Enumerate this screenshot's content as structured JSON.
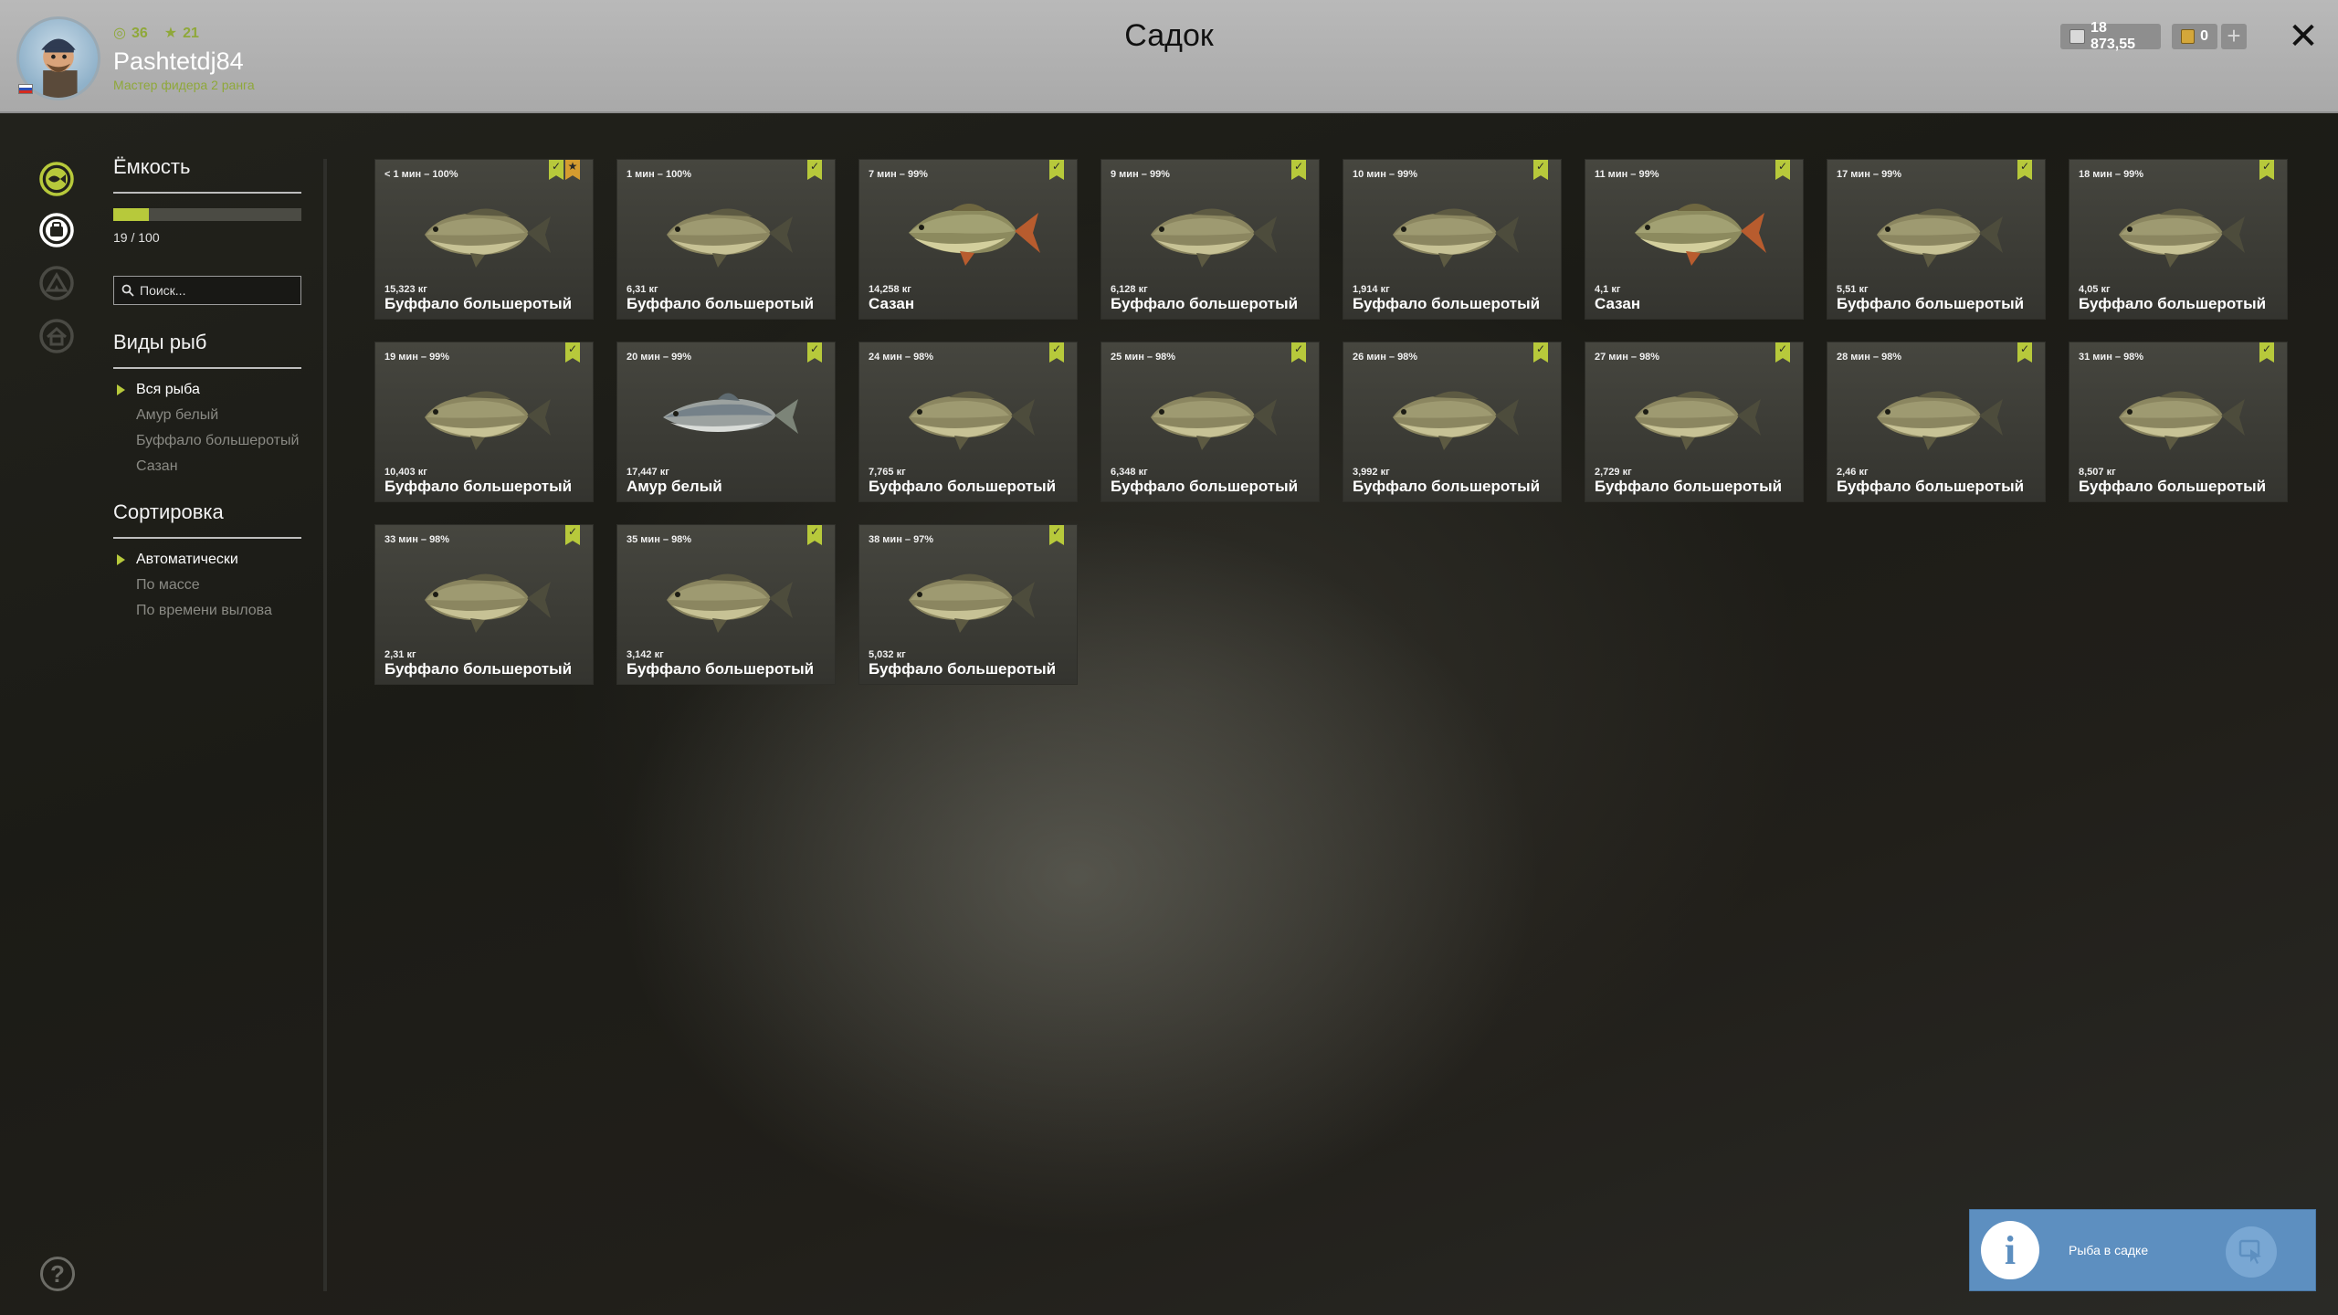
{
  "header": {
    "title": "Садок",
    "player": {
      "name": "Pashtetdj84",
      "rank": "Мастер фидера 2 ранга",
      "level": "36",
      "stars": "21"
    },
    "currency": {
      "silver": "18 873,55",
      "gold": "0"
    },
    "plus_label": "+",
    "close_label": "✕"
  },
  "nav": {
    "icons": [
      "fish-keepnet-icon",
      "inventory-bag-icon",
      "tent-icon",
      "house-icon"
    ],
    "help_label": "?"
  },
  "capacity": {
    "title": "Ёмкость",
    "text": "19 / 100",
    "fraction": 0.19
  },
  "search": {
    "placeholder": "Поиск..."
  },
  "types": {
    "title": "Виды рыб",
    "items": [
      "Вся рыба",
      "Амур белый",
      "Буффало большеротый",
      "Сазан"
    ],
    "active": 0
  },
  "sort": {
    "title": "Сортировка",
    "items": [
      "Автоматически",
      "По массе",
      "По времени вылова"
    ],
    "active": 0
  },
  "fish": [
    {
      "time": "< 1 мин – 100%",
      "weight": "15,323 кг",
      "name": "Буффало большеротый",
      "kind": "buffalo",
      "star": true
    },
    {
      "time": "1 мин – 100%",
      "weight": "6,31 кг",
      "name": "Буффало большеротый",
      "kind": "buffalo",
      "star": false
    },
    {
      "time": "7 мин – 99%",
      "weight": "14,258 кг",
      "name": "Сазан",
      "kind": "carp",
      "star": false
    },
    {
      "time": "9 мин – 99%",
      "weight": "6,128 кг",
      "name": "Буффало большеротый",
      "kind": "buffalo",
      "star": false
    },
    {
      "time": "10 мин – 99%",
      "weight": "1,914 кг",
      "name": "Буффало большеротый",
      "kind": "buffalo",
      "star": false
    },
    {
      "time": "11 мин – 99%",
      "weight": "4,1 кг",
      "name": "Сазан",
      "kind": "carp",
      "star": false
    },
    {
      "time": "17 мин – 99%",
      "weight": "5,51 кг",
      "name": "Буффало большеротый",
      "kind": "buffalo",
      "star": false
    },
    {
      "time": "18 мин – 99%",
      "weight": "4,05 кг",
      "name": "Буффало большеротый",
      "kind": "buffalo",
      "star": false
    },
    {
      "time": "19 мин – 99%",
      "weight": "10,403 кг",
      "name": "Буффало большеротый",
      "kind": "buffalo",
      "star": false
    },
    {
      "time": "20 мин – 99%",
      "weight": "17,447 кг",
      "name": "Амур белый",
      "kind": "amur",
      "star": false
    },
    {
      "time": "24 мин – 98%",
      "weight": "7,765 кг",
      "name": "Буффало большеротый",
      "kind": "buffalo",
      "star": false
    },
    {
      "time": "25 мин – 98%",
      "weight": "6,348 кг",
      "name": "Буффало большеротый",
      "kind": "buffalo",
      "star": false
    },
    {
      "time": "26 мин – 98%",
      "weight": "3,992 кг",
      "name": "Буффало большеротый",
      "kind": "buffalo",
      "star": false
    },
    {
      "time": "27 мин – 98%",
      "weight": "2,729 кг",
      "name": "Буффало большеротый",
      "kind": "buffalo",
      "star": false
    },
    {
      "time": "28 мин – 98%",
      "weight": "2,46 кг",
      "name": "Буффало большеротый",
      "kind": "buffalo",
      "star": false
    },
    {
      "time": "31 мин – 98%",
      "weight": "8,507 кг",
      "name": "Буффало большеротый",
      "kind": "buffalo",
      "star": false
    },
    {
      "time": "33 мин – 98%",
      "weight": "2,31 кг",
      "name": "Буффало большеротый",
      "kind": "buffalo",
      "star": false
    },
    {
      "time": "35 мин – 98%",
      "weight": "3,142 кг",
      "name": "Буффало большеротый",
      "kind": "buffalo",
      "star": false
    },
    {
      "time": "38 мин – 97%",
      "weight": "5,032 кг",
      "name": "Буффало большеротый",
      "kind": "buffalo",
      "star": false
    }
  ],
  "notification": {
    "text": "Рыба в садке",
    "icon": "info-icon"
  },
  "colors": {
    "accent": "#b7c93b",
    "star": "#d59c2f",
    "notify": "#5d8fc0"
  }
}
